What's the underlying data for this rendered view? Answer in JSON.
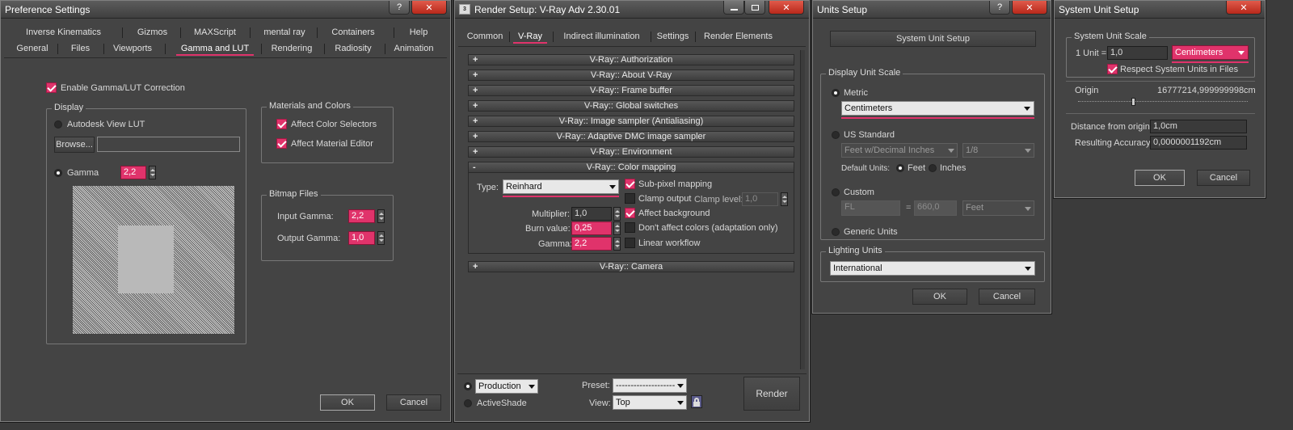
{
  "pref": {
    "title": "Preference Settings",
    "q": "?",
    "close": "✕",
    "tabs_row1": [
      "Inverse Kinematics",
      "Gizmos",
      "MAXScript",
      "mental ray",
      "Containers",
      "Help"
    ],
    "tabs_row2": [
      "General",
      "Files",
      "Viewports",
      "Gamma and LUT",
      "Rendering",
      "Radiosity",
      "Animation"
    ],
    "enable": "Enable Gamma/LUT Correction",
    "display": "Display",
    "autodesk_lut": "Autodesk View LUT",
    "browse": "Browse...",
    "gamma": "Gamma",
    "gamma_val": "2,2",
    "mat_colors": "Materials and Colors",
    "affect_color": "Affect Color Selectors",
    "affect_material": "Affect Material Editor",
    "bitmap_files": "Bitmap Files",
    "input_gamma": "Input Gamma:",
    "input_gamma_val": "2,2",
    "output_gamma": "Output Gamma:",
    "output_gamma_val": "1,0",
    "ok": "OK",
    "cancel": "Cancel"
  },
  "render": {
    "title": "Render Setup: V-Ray Adv 2.30.01",
    "app_icon": "3ds-max-icon",
    "tabs": [
      "Common",
      "V-Ray",
      "Indirect illumination",
      "Settings",
      "Render Elements"
    ],
    "rollouts": [
      "V-Ray:: Authorization",
      "V-Ray:: About V-Ray",
      "V-Ray:: Frame buffer",
      "V-Ray:: Global switches",
      "V-Ray:: Image sampler (Antialiasing)",
      "V-Ray:: Adaptive DMC image sampler",
      "V-Ray:: Environment"
    ],
    "plus": "+",
    "minus": "-",
    "color_mapping": "V-Ray:: Color mapping",
    "type_label": "Type:",
    "type_val": "Reinhard",
    "subpixel": "Sub-pixel mapping",
    "clamp_output": "Clamp output",
    "clamp_level": "Clamp level:",
    "clamp_level_val": "1,0",
    "multiplier": "Multiplier:",
    "multiplier_val": "1,0",
    "affect_bg": "Affect background",
    "burn": "Burn value:",
    "burn_val": "0,25",
    "dont_affect": "Don't affect colors (adaptation only)",
    "gamma": "Gamma:",
    "gamma_val": "2,2",
    "linear": "Linear workflow",
    "camera": "V-Ray:: Camera",
    "production": "Production",
    "activeshade": "ActiveShade",
    "preset": "Preset:",
    "preset_val": "--------------------",
    "view": "View:",
    "view_val": "Top",
    "render": "Render"
  },
  "units": {
    "title": "Units Setup",
    "system_unit_setup": "System Unit Setup",
    "display_unit_scale": "Display Unit Scale",
    "metric": "Metric",
    "metric_val": "Centimeters",
    "us_standard": "US Standard",
    "us_val": "Feet w/Decimal Inches",
    "frac_val": "1/8",
    "default_units": "Default Units:",
    "feet": "Feet",
    "inches": "Inches",
    "custom": "Custom",
    "custom_name": "FL",
    "custom_eq": "=",
    "custom_val": "660,0",
    "custom_unit": "Feet",
    "generic": "Generic Units",
    "lighting_units": "Lighting Units",
    "lighting_val": "International",
    "ok": "OK",
    "cancel": "Cancel"
  },
  "sys": {
    "title": "System Unit Setup",
    "scale": "System Unit Scale",
    "one_unit": "1 Unit =",
    "one_unit_val": "1,0",
    "unit_val": "Centimeters",
    "respect": "Respect System Units in Files",
    "origin": "Origin",
    "origin_val": "16777214,999999998cm",
    "distance": "Distance from origin:",
    "distance_val": "1,0cm",
    "accuracy": "Resulting Accuracy:",
    "accuracy_val": "0,0000001192cm",
    "ok": "OK",
    "cancel": "Cancel"
  }
}
